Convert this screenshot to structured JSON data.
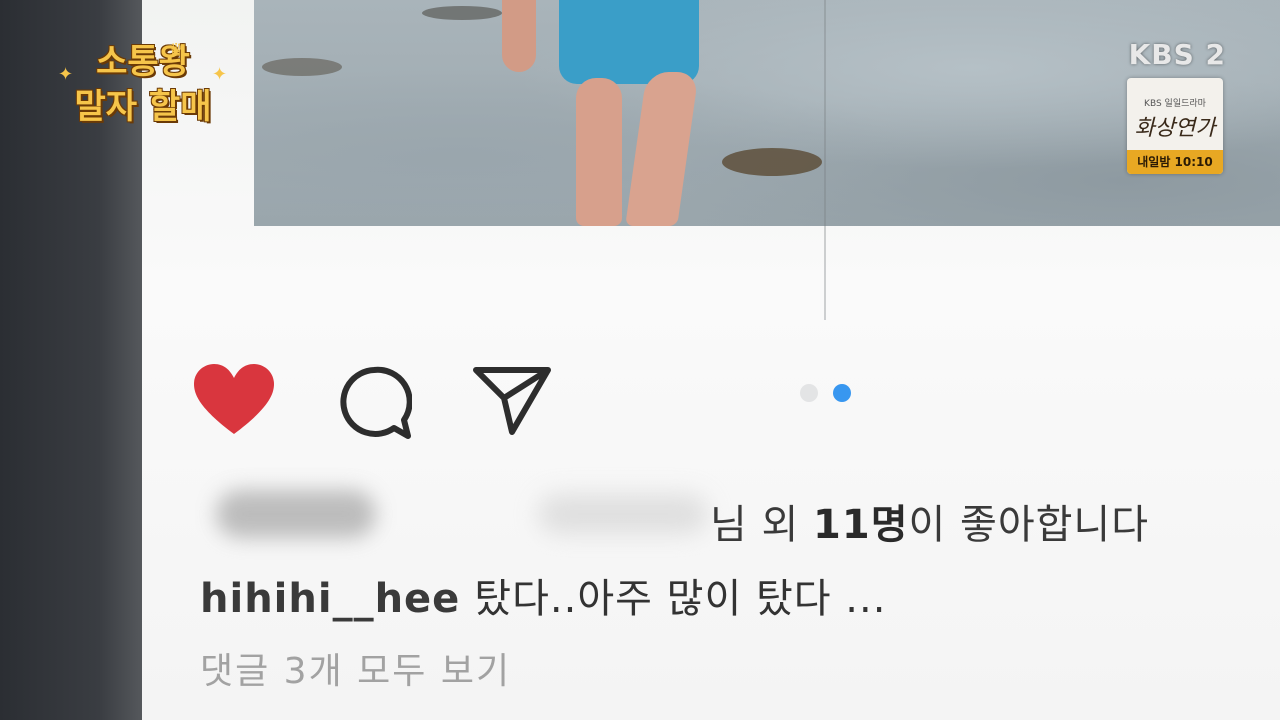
{
  "show": {
    "title_line1": "소통왕",
    "title_line2": "말자 할매"
  },
  "broadcaster": {
    "logo": "KBS 2"
  },
  "promo": {
    "network": "KBS 일일드라마",
    "drama": "화상연가",
    "schedule": "내일밤 10:10"
  },
  "post": {
    "actions": {
      "like_icon": "heart-icon",
      "comment_icon": "comment-icon",
      "share_icon": "send-icon",
      "liked": true
    },
    "carousel": {
      "count": 2,
      "active": 2,
      "active_color": "#3897f0"
    },
    "likes": {
      "suffix_pre": "님 외 ",
      "count": "11명",
      "suffix_post": "이 좋아합니다"
    },
    "caption": {
      "username": "hihihi__hee",
      "text": "탔다..아주 많이 탔다 ..."
    },
    "view_all_comments": "댓글 3개 모두 보기"
  },
  "colors": {
    "like_red": "#d9363e",
    "link_blue": "#3897f0"
  }
}
